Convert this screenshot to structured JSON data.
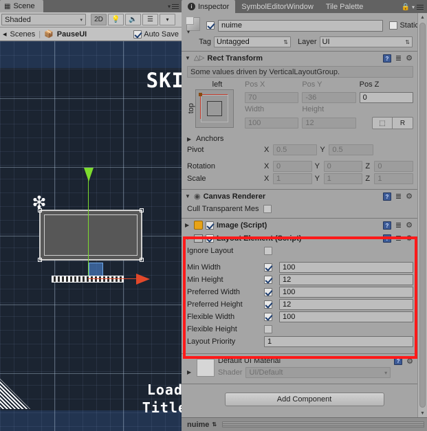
{
  "scene": {
    "tab_label": "Scene",
    "tab_icon": "grid-icon",
    "toolbar": {
      "draw_mode": "Shaded",
      "mode_2d": "2D",
      "lighting_icon": "lightbulb-icon",
      "audio_icon": "speaker-icon",
      "fx_icon": "effects-icon",
      "fx_dropdown_arrow": "▾"
    },
    "breadcrumb": {
      "scenes_label": "Scenes",
      "separator": "|",
      "scene_name": "PauseUI",
      "autosave_label": "Auto Save",
      "autosave_checked": true
    },
    "viewport_text": {
      "skip": "SKI",
      "load": "Load",
      "title": "Title"
    }
  },
  "inspector": {
    "tabs": [
      {
        "label": "Inspector",
        "icon": "info-icon",
        "active": true
      },
      {
        "label": "SymbolEditorWindow",
        "active": false
      },
      {
        "label": "Tile Palette",
        "active": false
      }
    ],
    "lock_icon": "lock-icon",
    "menu_icon": "hamburger-icon",
    "header": {
      "enabled": true,
      "name_value": "nuime",
      "static_label": "Static",
      "static_checked": false,
      "tag_label": "Tag",
      "tag_value": "Untagged",
      "layer_label": "Layer",
      "layer_value": "UI"
    },
    "rect_transform": {
      "title": "Rect Transform",
      "info": "Some values driven by VerticalLayoutGroup.",
      "anchor_top_label": "left",
      "anchor_left_label": "top",
      "pos_x_label": "Pos X",
      "pos_x": "70",
      "pos_y_label": "Pos Y",
      "pos_y": "-36",
      "pos_z_label": "Pos Z",
      "pos_z": "0",
      "width_label": "Width",
      "width": "100",
      "height_label": "Height",
      "height": "12",
      "blueprint_btn": "⬚",
      "raw_btn": "R",
      "anchors_label": "Anchors",
      "pivot_label": "Pivot",
      "pivot_x": "0.5",
      "pivot_y": "0.5",
      "rotation_label": "Rotation",
      "rot_x": "0",
      "rot_y": "0",
      "rot_z": "0",
      "scale_label": "Scale",
      "scale_x": "1",
      "scale_y": "1",
      "scale_z": "1",
      "x_label": "X",
      "y_label": "Y",
      "z_label": "Z"
    },
    "canvas_renderer": {
      "title": "Canvas Renderer",
      "cull_label": "Cull Transparent Mes",
      "cull_checked": false
    },
    "image_component": {
      "title": "Image (Script)",
      "enabled": true
    },
    "layout_element": {
      "title": "Layout Element (Script)",
      "enabled": true,
      "highlight_color": "#ff1a1a",
      "rows": [
        {
          "label": "Ignore Layout",
          "checked": false,
          "value": null,
          "has_value": false
        },
        {
          "label": "Min Width",
          "checked": true,
          "value": "100",
          "has_value": true
        },
        {
          "label": "Min Height",
          "checked": true,
          "value": "12",
          "has_value": true
        },
        {
          "label": "Preferred Width",
          "checked": true,
          "value": "100",
          "has_value": true
        },
        {
          "label": "Preferred Height",
          "checked": true,
          "value": "12",
          "has_value": true
        },
        {
          "label": "Flexible Width",
          "checked": true,
          "value": "100",
          "has_value": true
        },
        {
          "label": "Flexible Height",
          "checked": false,
          "value": null,
          "has_value": false
        },
        {
          "label": "Layout Priority",
          "checked": null,
          "value": "1",
          "has_value": true
        }
      ]
    },
    "material": {
      "name": "Default UI Material",
      "shader_label": "Shader",
      "shader_value": "UI/Default"
    },
    "add_component_label": "Add Component",
    "footer": {
      "object_name": "nuime"
    }
  }
}
